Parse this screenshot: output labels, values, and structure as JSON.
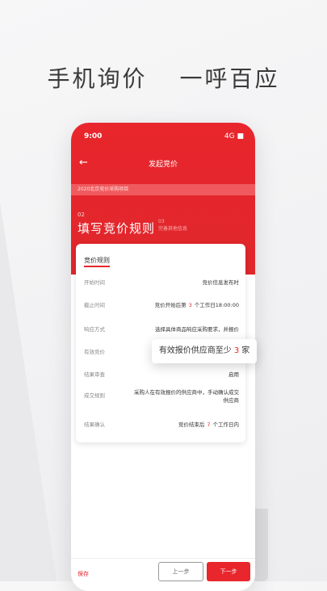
{
  "slogan": {
    "left": "手机询价",
    "right": "一呼百应"
  },
  "status_bar": {
    "time": "9:00",
    "signal": "4G ■"
  },
  "nav": {
    "title": "发起竞价"
  },
  "breadcrumb": "2020北京竞价采购项目",
  "step": {
    "number": "02",
    "title": "填写竞价规则",
    "next_number": "03",
    "next_title": "完善其他信息"
  },
  "card": {
    "title": "竞价规则",
    "rows": [
      {
        "label": "开始时间",
        "value": "竞价信息发布时"
      },
      {
        "label": "截止时间",
        "value_prefix": "竞价开始后第",
        "value_num": "3",
        "value_suffix": "个工作日18:00:00"
      },
      {
        "label": "响应方式",
        "value": "选择具体商品响应采购要求，并报价"
      },
      {
        "label": "有效竞价",
        "value": ""
      },
      {
        "label": "结果审查",
        "value": "启用"
      },
      {
        "label": "成交规则",
        "value": "采购人在有效报价的供应商中，手动确认成交供应商"
      },
      {
        "label": "结果确认",
        "value_prefix": "竞价结束后",
        "value_num": "7",
        "value_suffix": "个工作日内"
      }
    ]
  },
  "popup": {
    "prefix": "有效报价供应商至少",
    "num": "3",
    "suffix": "家"
  },
  "footer": {
    "save": "保存",
    "prev": "上一步",
    "next": "下一步"
  },
  "colors": {
    "accent": "#e8262c"
  }
}
